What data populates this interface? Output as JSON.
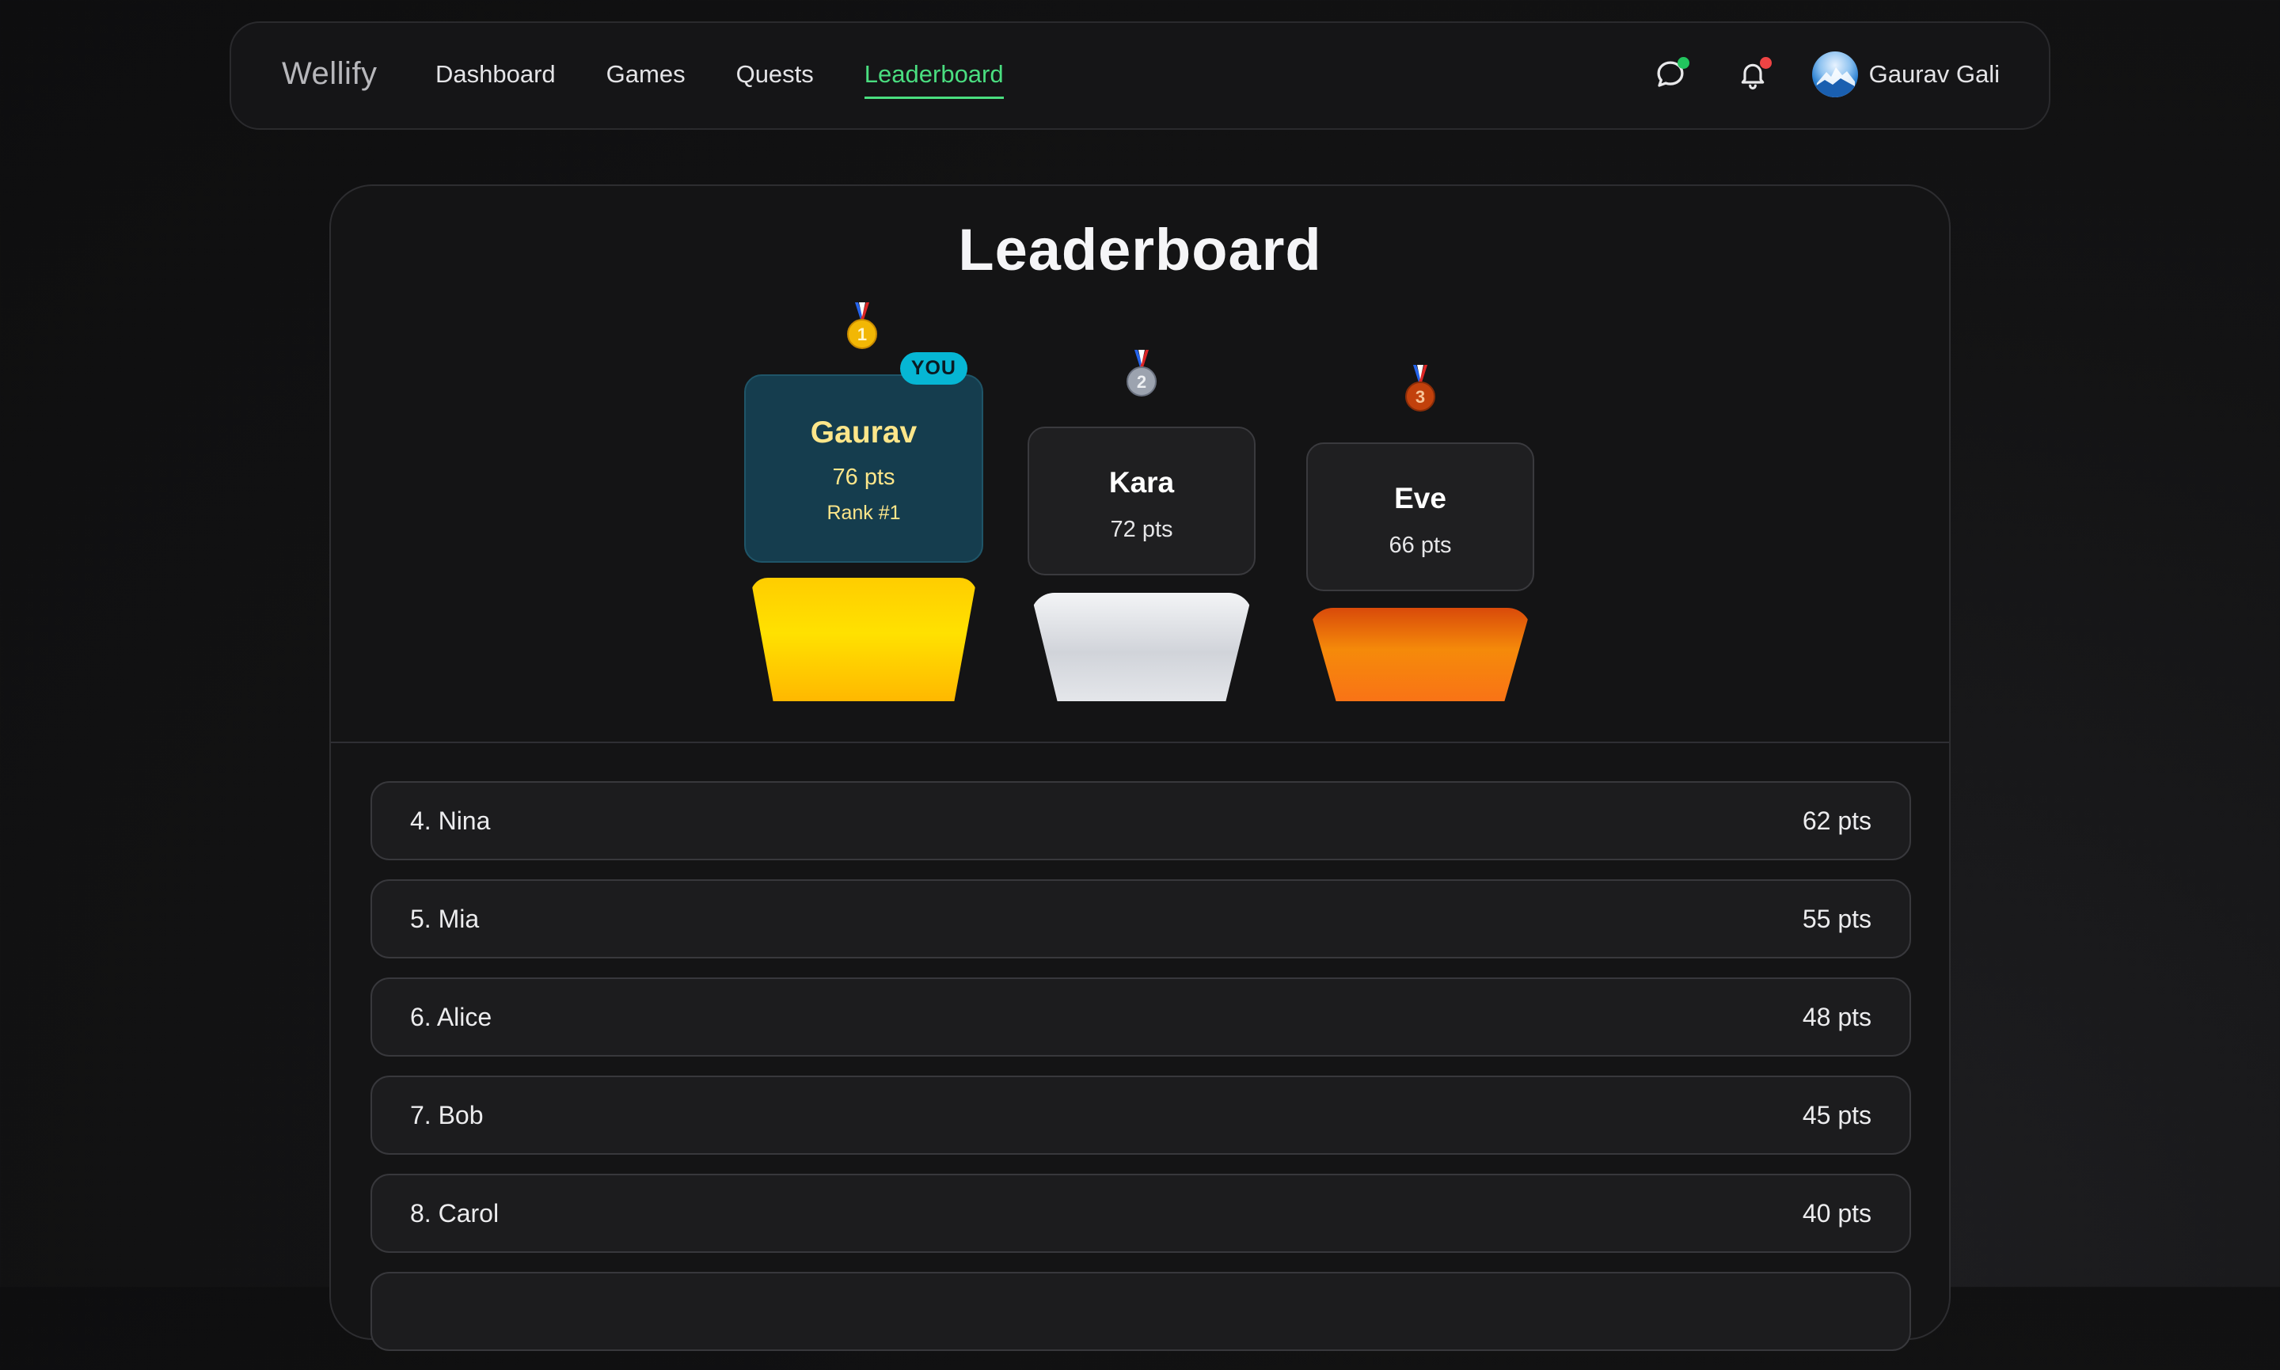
{
  "app": {
    "brand": "Wellify"
  },
  "nav": {
    "links": [
      {
        "label": "Dashboard",
        "active": false
      },
      {
        "label": "Games",
        "active": false
      },
      {
        "label": "Quests",
        "active": false
      },
      {
        "label": "Leaderboard",
        "active": true
      }
    ],
    "icons": {
      "chat": "chat-bubble-icon",
      "notifications": "bell-icon"
    },
    "badge_colors": {
      "chat": "#22c55e",
      "notifications": "#ef4444"
    },
    "user": {
      "name": "Gaurav Gali",
      "avatar": "avatar-image"
    }
  },
  "page": {
    "title": "Leaderboard"
  },
  "podium": [
    {
      "place": 1,
      "name": "Gaurav",
      "points": "76 pts",
      "rank_label": "Rank #1",
      "badge": "YOU",
      "medal": "gold-medal-icon",
      "medal_number": "1"
    },
    {
      "place": 2,
      "name": "Kara",
      "points": "72 pts",
      "medal": "silver-medal-icon",
      "medal_number": "2"
    },
    {
      "place": 3,
      "name": "Eve",
      "points": "66 pts",
      "medal": "bronze-medal-icon",
      "medal_number": "3"
    }
  ],
  "leaderboard": [
    {
      "label": "4. Nina",
      "points": "62 pts"
    },
    {
      "label": "5. Mia",
      "points": "55 pts"
    },
    {
      "label": "6. Alice",
      "points": "48 pts"
    },
    {
      "label": "7. Bob",
      "points": "45 pts"
    },
    {
      "label": "8. Carol",
      "points": "40 pts"
    },
    {
      "label": "",
      "points": ""
    }
  ],
  "colors": {
    "accent": "#4ade80",
    "you_badge": "#06b6d4",
    "first_card": "#153d4e",
    "gold": "#ffd000",
    "silver": "#d9dbe0",
    "bronze": "#f58a0a"
  }
}
